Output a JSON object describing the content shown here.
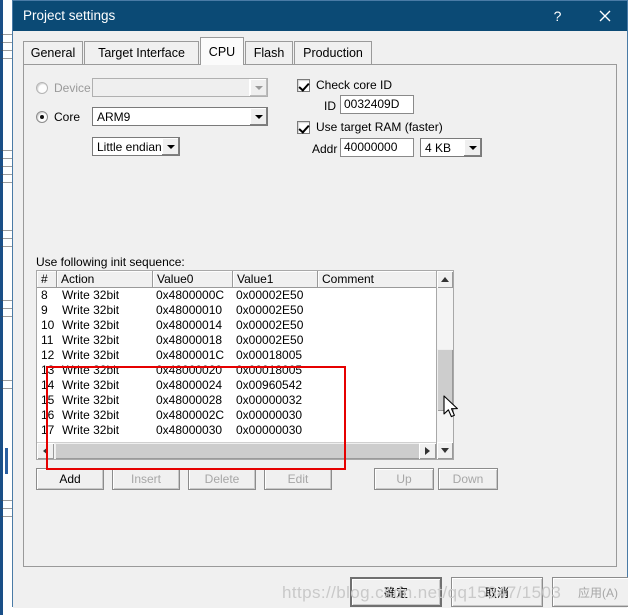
{
  "window": {
    "title": "Project settings",
    "help_label": "?",
    "close_label": "✕"
  },
  "tabs": [
    {
      "label": "General",
      "active": false
    },
    {
      "label": "Target Interface",
      "active": false
    },
    {
      "label": "CPU",
      "active": true
    },
    {
      "label": "Flash",
      "active": false
    },
    {
      "label": "Production",
      "active": false
    }
  ],
  "cpu": {
    "device": {
      "radio_label": "Device",
      "selected": false,
      "value": "",
      "enabled": false
    },
    "core": {
      "radio_label": "Core",
      "selected": true,
      "value": "ARM9",
      "enabled": true
    },
    "endian": {
      "value": "Little endian"
    },
    "check_core_id": {
      "label": "Check core ID",
      "checked": true,
      "id_label": "ID",
      "id_value": "0032409D"
    },
    "use_target_ram": {
      "label": "Use target RAM (faster)",
      "checked": true,
      "addr_label": "Addr",
      "addr_value": "40000000",
      "size_value": "4 KB"
    },
    "init_sequence": {
      "caption": "Use following init sequence:",
      "columns": [
        "#",
        "Action",
        "Value0",
        "Value1",
        "Comment"
      ],
      "rows": [
        {
          "num": "8",
          "action": "Write 32bit",
          "value0": "0x4800000C",
          "value1": "0x00002E50",
          "comment": ""
        },
        {
          "num": "9",
          "action": "Write 32bit",
          "value0": "0x48000010",
          "value1": "0x00002E50",
          "comment": ""
        },
        {
          "num": "10",
          "action": "Write 32bit",
          "value0": "0x48000014",
          "value1": "0x00002E50",
          "comment": ""
        },
        {
          "num": "11",
          "action": "Write 32bit",
          "value0": "0x48000018",
          "value1": "0x00002E50",
          "comment": ""
        },
        {
          "num": "12",
          "action": "Write 32bit",
          "value0": "0x4800001C",
          "value1": "0x00018005",
          "comment": ""
        },
        {
          "num": "13",
          "action": "Write 32bit",
          "value0": "0x48000020",
          "value1": "0x00018005",
          "comment": ""
        },
        {
          "num": "14",
          "action": "Write 32bit",
          "value0": "0x48000024",
          "value1": "0x00960542",
          "comment": ""
        },
        {
          "num": "15",
          "action": "Write 32bit",
          "value0": "0x48000028",
          "value1": "0x00000032",
          "comment": ""
        },
        {
          "num": "16",
          "action": "Write 32bit",
          "value0": "0x4800002C",
          "value1": "0x00000030",
          "comment": ""
        },
        {
          "num": "17",
          "action": "Write 32bit",
          "value0": "0x48000030",
          "value1": "0x00000030",
          "comment": ""
        }
      ]
    },
    "list_buttons": [
      {
        "label": "Add",
        "enabled": true
      },
      {
        "label": "Insert",
        "enabled": false
      },
      {
        "label": "Delete",
        "enabled": false
      },
      {
        "label": "Edit",
        "enabled": false
      },
      {
        "label": "Up",
        "enabled": false
      },
      {
        "label": "Down",
        "enabled": false
      }
    ]
  },
  "footer": {
    "ok_label": "确定",
    "cancel_label": "取消",
    "apply_label": "应用(A)",
    "apply_enabled": false
  },
  "watermark": {
    "text": "https://blog.csdn.net/qq15347/1503"
  },
  "colors": {
    "titlebar": "#0b4a75",
    "dialog_bg": "#f0f0f0",
    "annotation": "#e60000"
  }
}
